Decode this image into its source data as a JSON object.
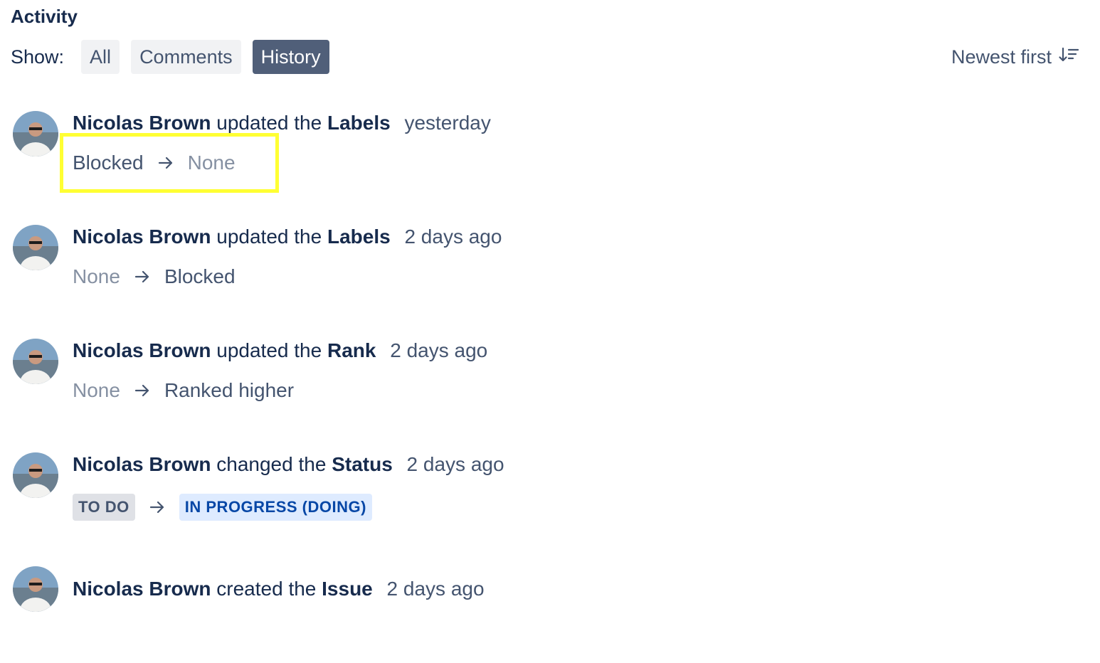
{
  "header": {
    "title": "Activity"
  },
  "filters": {
    "show_label": "Show:",
    "options": [
      {
        "label": "All",
        "selected": false
      },
      {
        "label": "Comments",
        "selected": false
      },
      {
        "label": "History",
        "selected": true
      }
    ],
    "sort_label": "Newest first"
  },
  "entries": [
    {
      "actor": "Nicolas Brown",
      "verb": "updated the",
      "field": "Labels",
      "time": "yesterday",
      "from": "Blocked",
      "to": "None"
    },
    {
      "actor": "Nicolas Brown",
      "verb": "updated the",
      "field": "Labels",
      "time": "2 days ago",
      "from": "None",
      "to": "Blocked"
    },
    {
      "actor": "Nicolas Brown",
      "verb": "updated the",
      "field": "Rank",
      "time": "2 days ago",
      "from": "None",
      "to": "Ranked higher"
    },
    {
      "actor": "Nicolas Brown",
      "verb": "changed the",
      "field": "Status",
      "time": "2 days ago",
      "from": "TO DO",
      "to": "IN PROGRESS (DOING)"
    },
    {
      "actor": "Nicolas Brown",
      "verb": "created the",
      "field": "Issue",
      "time": "2 days ago"
    }
  ],
  "colors": {
    "selected_filter_bg": "#505f79",
    "highlight_border": "#ffff33",
    "status_todo_bg": "#dfe1e6",
    "status_inprogress_bg": "#deebff",
    "status_inprogress_text": "#0747a6"
  },
  "icons": {
    "sort": "sort-descending-icon",
    "arrow": "arrow-right-icon",
    "avatar": "user-avatar"
  }
}
